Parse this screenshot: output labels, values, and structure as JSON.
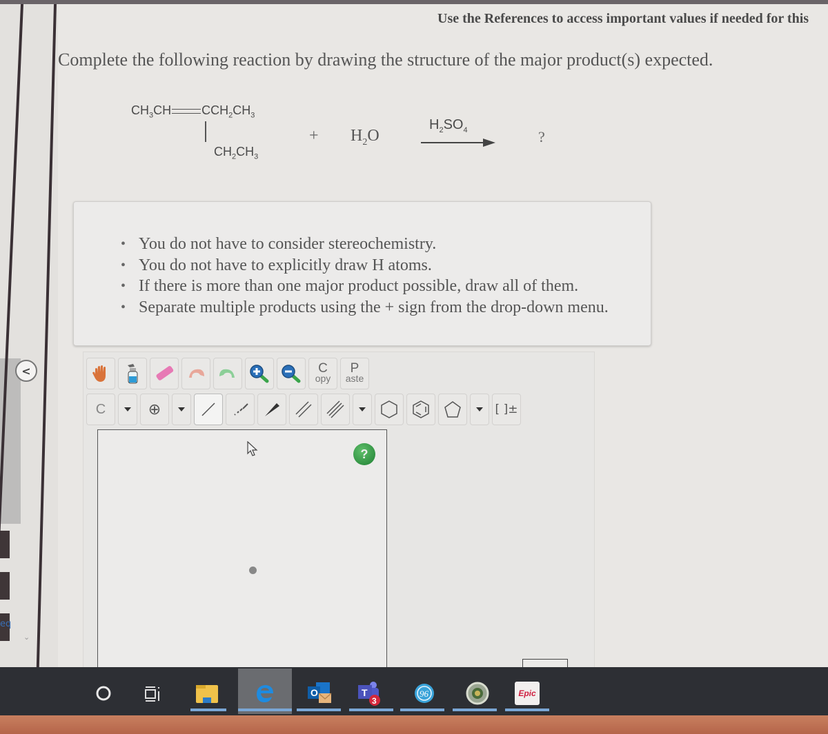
{
  "header": {
    "references_note": "Use the References to access important values if needed for this"
  },
  "question": {
    "prompt": "Complete the following reaction by drawing the structure of the major product(s) expected.",
    "reaction": {
      "reactant_top_left": "CH3CH",
      "reactant_top_right": "CCH2CH3",
      "reactant_branch": "CH2CH3",
      "plus": "+",
      "reagent": "H2O",
      "catalyst": "H2SO4",
      "product": "?"
    },
    "instructions": [
      "You do not have to consider stereochemistry.",
      "You do not have to explicitly draw H atoms.",
      "If there is more than one major product possible, draw all of them.",
      "Separate multiple products using the + sign from the drop-down menu."
    ]
  },
  "editor": {
    "toolbar_row1": [
      {
        "name": "move-tool",
        "icon": "hand-icon"
      },
      {
        "name": "clear-tool",
        "icon": "spray-bottle-icon"
      },
      {
        "name": "erase-tool",
        "icon": "eraser-icon"
      },
      {
        "name": "undo",
        "icon": "undo-icon"
      },
      {
        "name": "redo",
        "icon": "redo-icon"
      },
      {
        "name": "zoom-in",
        "icon": "zoom-in-icon"
      },
      {
        "name": "zoom-out",
        "icon": "zoom-out-icon"
      }
    ],
    "copy_letter": "C",
    "copy_rest": "opy",
    "paste_letter": "P",
    "paste_rest": "aste",
    "atom_selector": "C",
    "charge_symbol": "⊕",
    "bracket_label": "[ ]±",
    "help_label": "?",
    "accent_color": "#2e8b3e"
  },
  "sidebar": {
    "collapse_label": "<",
    "tab_label": "eq"
  },
  "taskbar": {
    "items": [
      {
        "name": "cortana",
        "icon": "circle-icon"
      },
      {
        "name": "task-view",
        "icon": "task-view-icon"
      },
      {
        "name": "file-explorer",
        "icon": "folder-icon"
      },
      {
        "name": "edge",
        "icon": "edge-icon"
      },
      {
        "name": "outlook",
        "icon": "outlook-icon",
        "label": "O"
      },
      {
        "name": "teams",
        "icon": "teams-icon",
        "label": "T",
        "badge": "3"
      },
      {
        "name": "ge-app",
        "icon": "ge-icon"
      },
      {
        "name": "seal-app",
        "icon": "seal-icon"
      },
      {
        "name": "epic",
        "icon": "epic-icon",
        "label": "Epic"
      }
    ]
  }
}
